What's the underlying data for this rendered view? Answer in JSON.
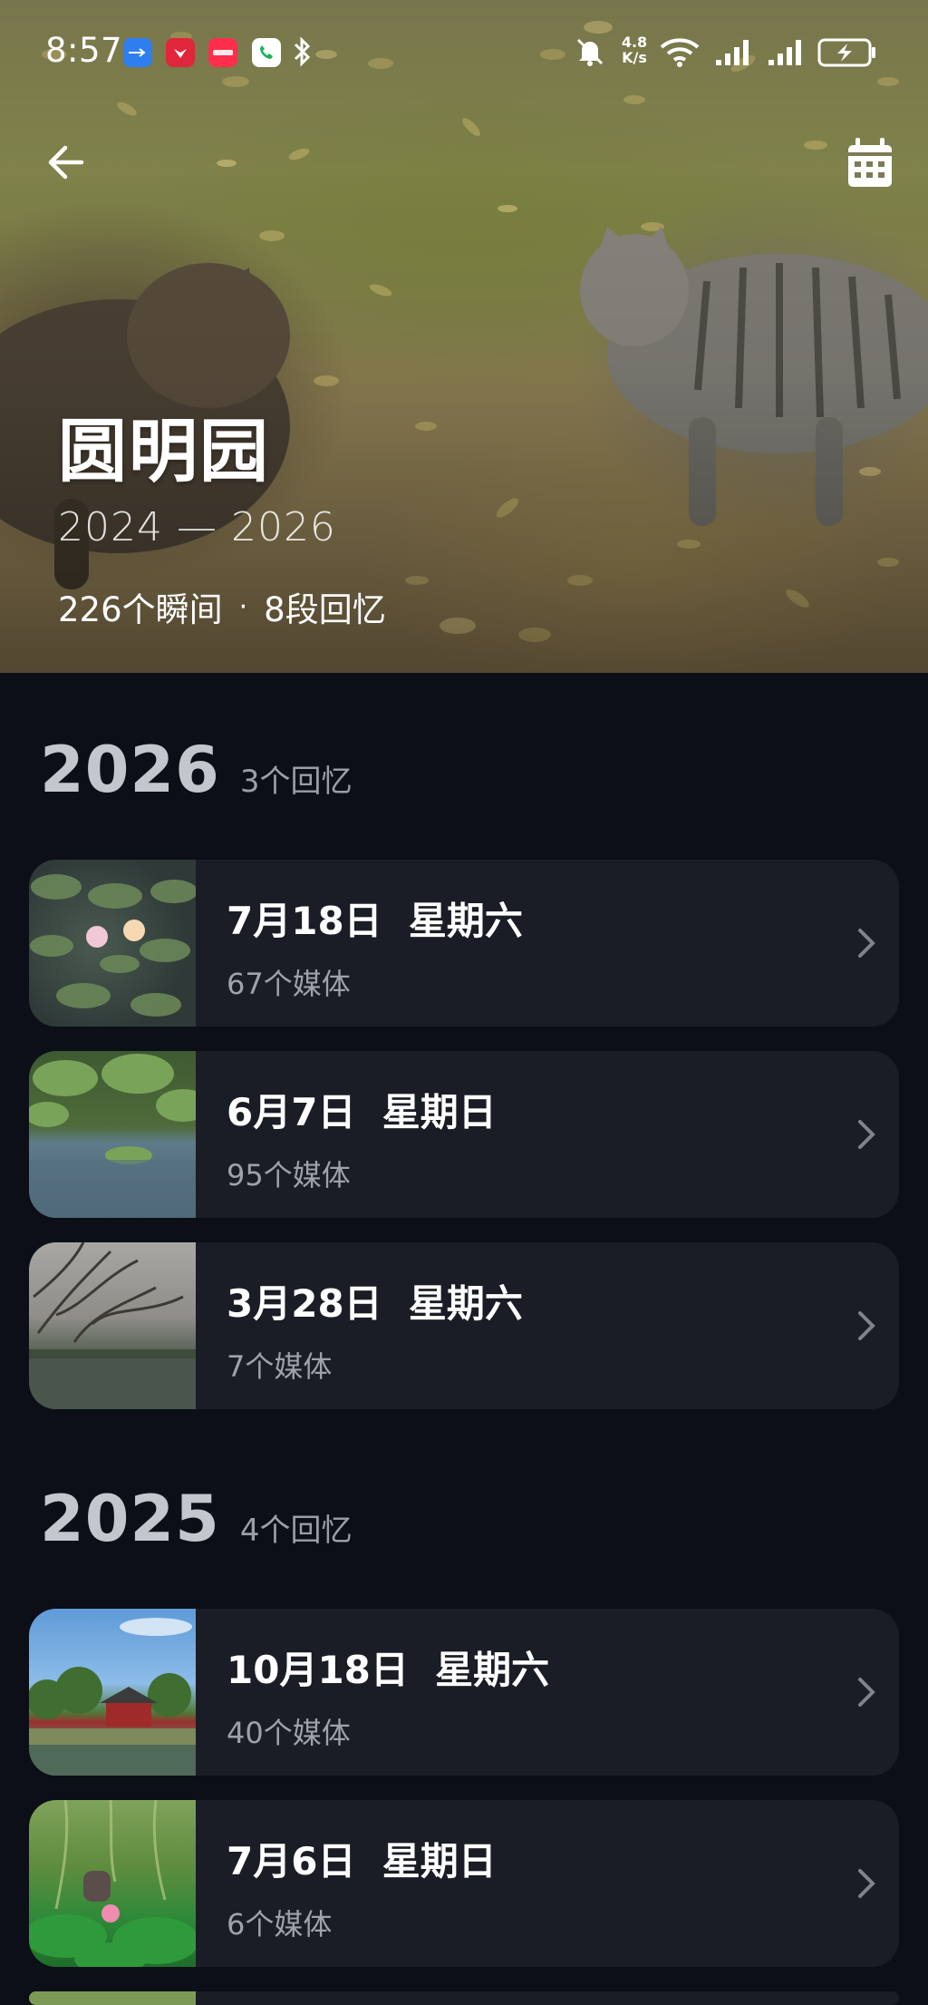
{
  "status_bar": {
    "time": "8:57",
    "network_speed_value": "4.8",
    "network_speed_unit": "K/s",
    "app_badges": [
      "usb-icon",
      "huawei-app-icon",
      "xiaohongshu-app-icon",
      "phone-app-icon",
      "bluetooth-icon"
    ],
    "right_icons": [
      "mute-icon",
      "wifi-icon",
      "signal-icon",
      "signal-icon-2",
      "battery-charging-icon"
    ]
  },
  "header": {
    "title": "圆明园",
    "years": "2024 — 2026",
    "moments": "226个瞬间",
    "separator": "·",
    "memories": "8段回忆"
  },
  "sections": [
    {
      "year": "2026",
      "count": "3个回忆",
      "items": [
        {
          "date": "7月18日  星期六",
          "media": "67个媒体",
          "thumb": "lily-pads"
        },
        {
          "date": "6月7日  星期日",
          "media": "95个媒体",
          "thumb": "pond"
        },
        {
          "date": "3月28日  星期六",
          "media": "7个媒体",
          "thumb": "bare-tree-lake"
        }
      ]
    },
    {
      "year": "2025",
      "count": "4个回忆",
      "items": [
        {
          "date": "10月18日  星期六",
          "media": "40个媒体",
          "thumb": "pavilion"
        },
        {
          "date": "7月6日  星期日",
          "media": "6个媒体",
          "thumb": "lotus"
        }
      ]
    }
  ]
}
